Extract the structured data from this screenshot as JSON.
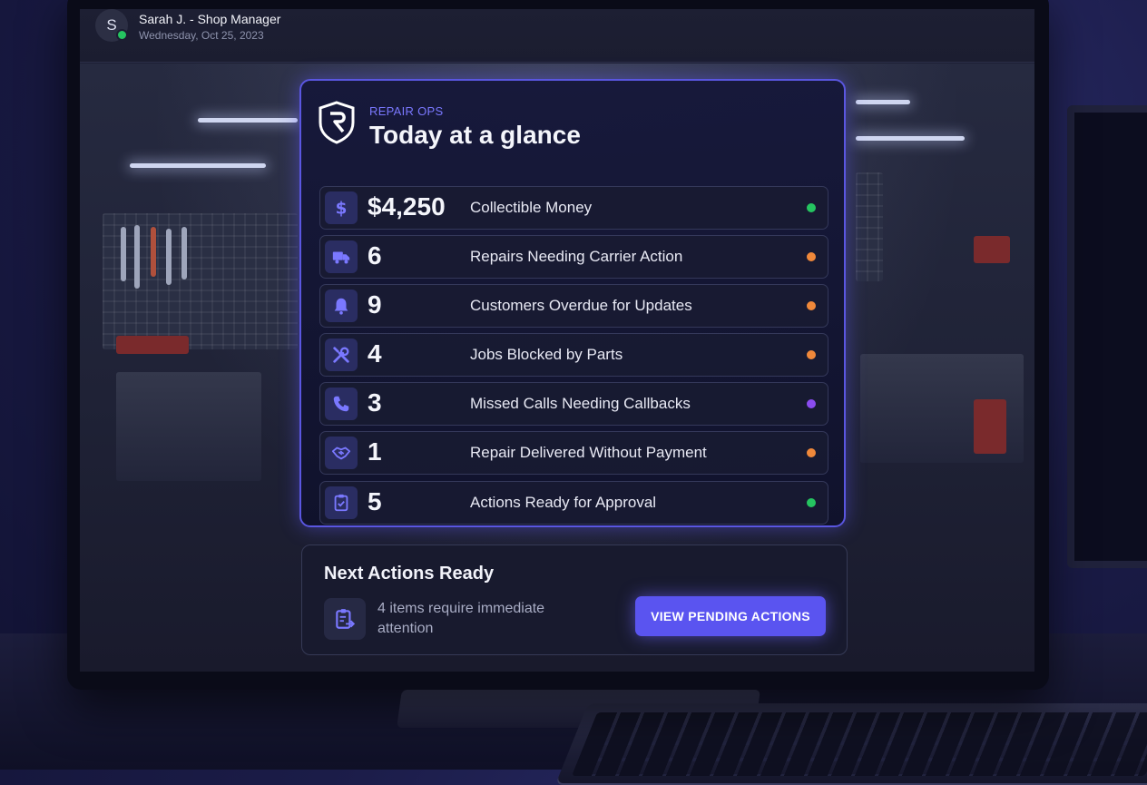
{
  "user": {
    "initial": "S",
    "name": "Sarah J. - Shop Manager",
    "date": "Wednesday, Oct 25, 2023",
    "status_color": "#25c460"
  },
  "panel": {
    "eyebrow": "REPAIR OPS",
    "title": "Today at a glance",
    "rows": [
      {
        "icon": "dollar-icon",
        "value": "$4,250",
        "label": "Collectible Money",
        "status_color": "#25c460"
      },
      {
        "icon": "truck-icon",
        "value": "6",
        "label": "Repairs Needing Carrier Action",
        "status_color": "#f0883a"
      },
      {
        "icon": "bell-icon",
        "value": "9",
        "label": "Customers Overdue for Updates",
        "status_color": "#f0883a"
      },
      {
        "icon": "wrench-icon",
        "value": "4",
        "label": "Jobs Blocked by Parts",
        "status_color": "#f0883a"
      },
      {
        "icon": "phone-icon",
        "value": "3",
        "label": "Missed Calls Needing Callbacks",
        "status_color": "#8a4cf0"
      },
      {
        "icon": "handshake-icon",
        "value": "1",
        "label": "Repair Delivered Without Payment",
        "status_color": "#f0883a"
      },
      {
        "icon": "clipboard-check-icon",
        "value": "5",
        "label": "Actions Ready for Approval",
        "status_color": "#25c460"
      }
    ]
  },
  "next_actions": {
    "title": "Next Actions Ready",
    "description": "4 items require immediate attention",
    "button_label": "VIEW PENDING ACTIONS"
  },
  "colors": {
    "accent": "#5a54f0",
    "panel_border": "#5a56e0",
    "icon_tint": "#7a78ff"
  }
}
